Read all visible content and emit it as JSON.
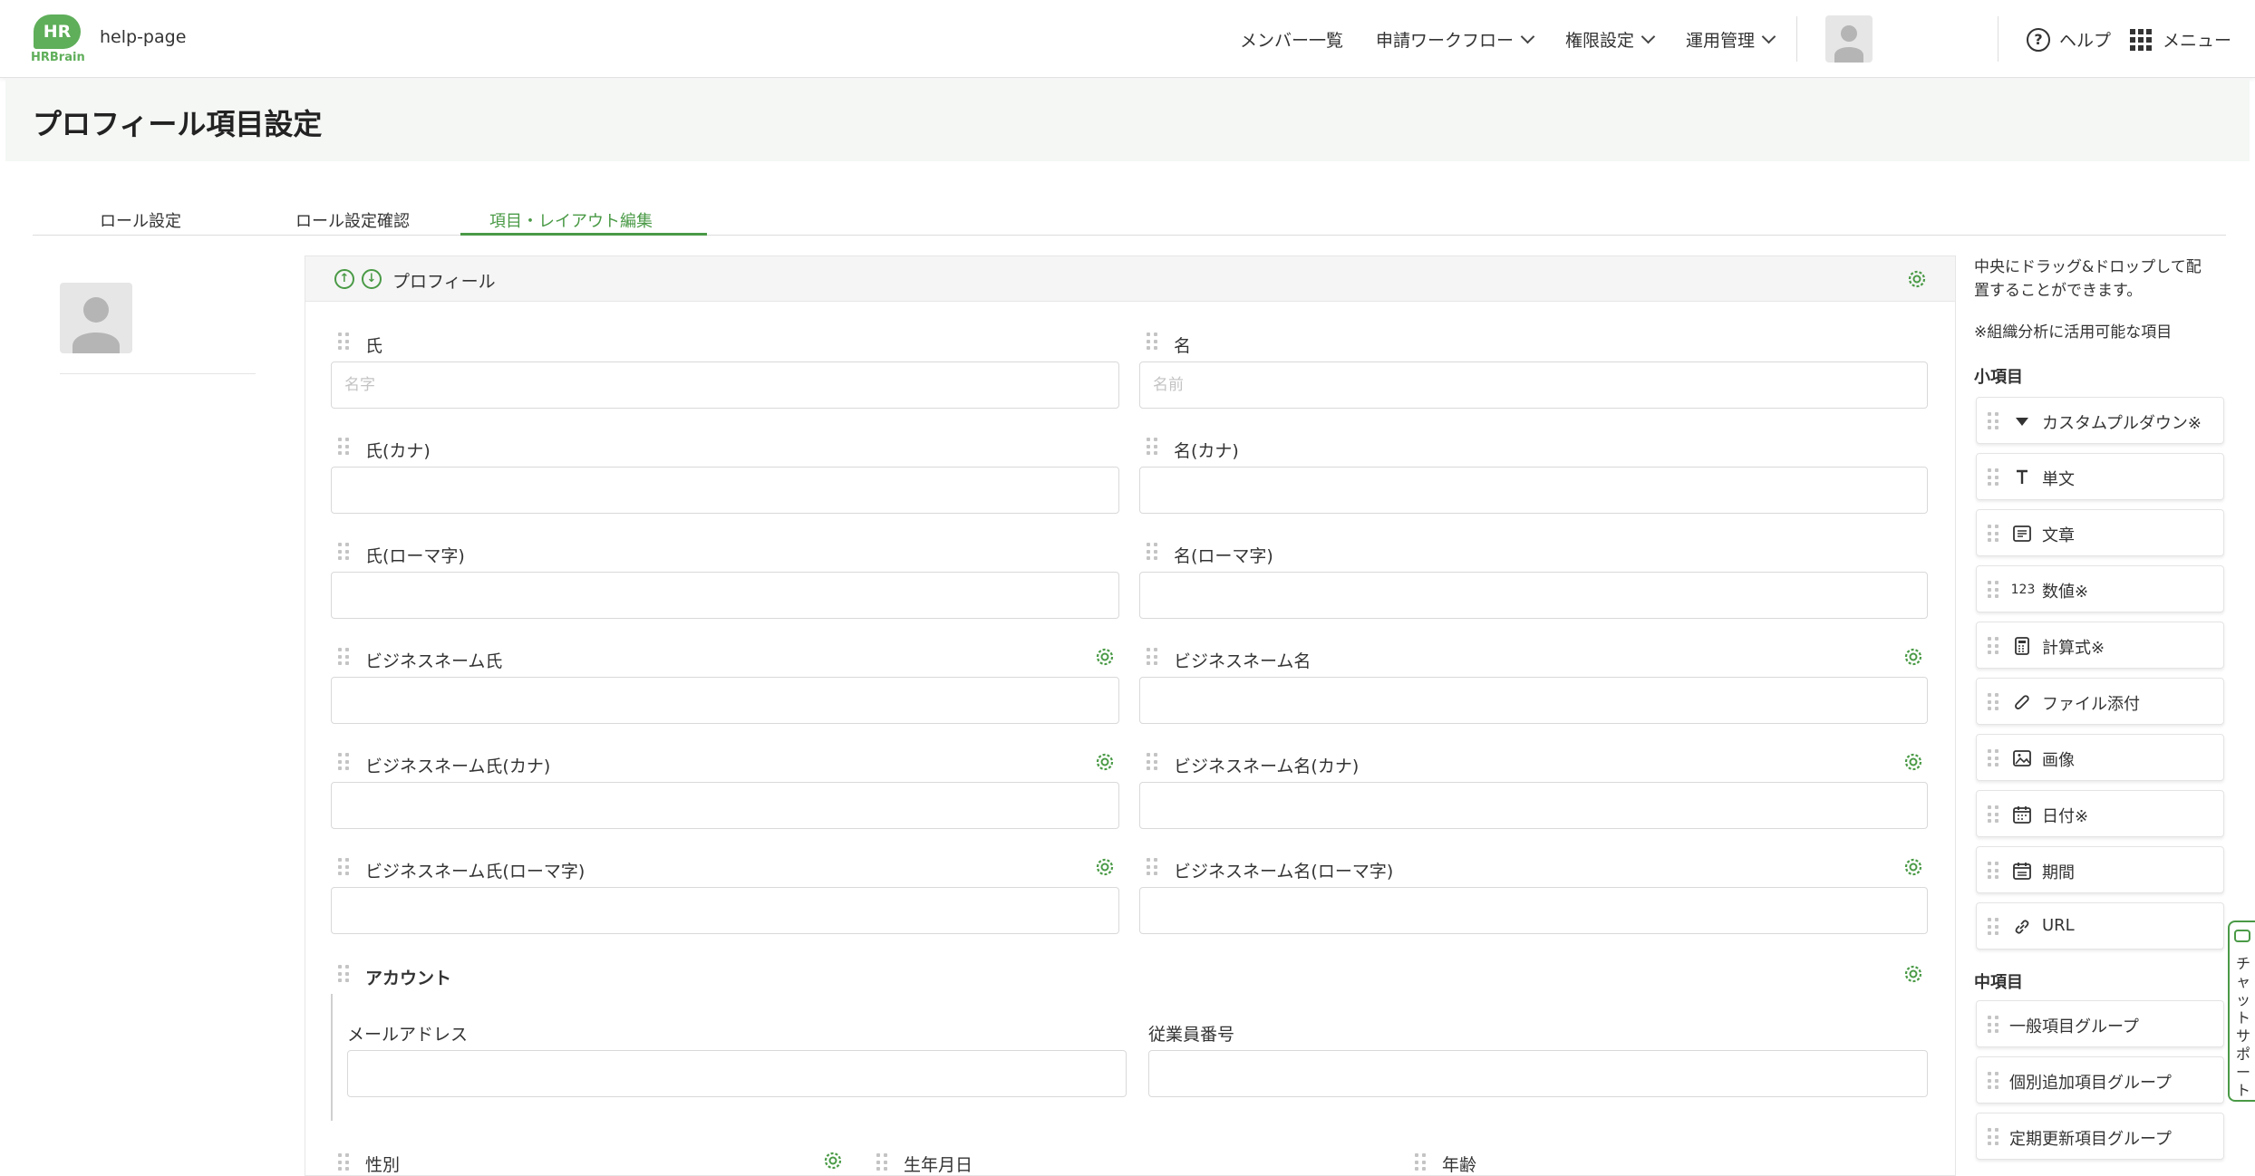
{
  "header": {
    "logo_text": "HR",
    "logo_sub": "HRBrain",
    "site_name": "help-page",
    "nav": [
      {
        "label": "メンバー一覧"
      },
      {
        "label": "申請ワークフロー"
      },
      {
        "label": "権限設定"
      },
      {
        "label": "運用管理"
      }
    ],
    "help_label": "ヘルプ",
    "menu_label": "メニュー"
  },
  "page": {
    "title": "プロフィール項目設定"
  },
  "tabs": [
    {
      "label": "ロール設定"
    },
    {
      "label": "ロール設定確認"
    },
    {
      "label": "項目・レイアウト編集"
    }
  ],
  "panel": {
    "title": "プロフィール",
    "fields": {
      "last_name": {
        "label": "氏",
        "placeholder": "名字"
      },
      "first_name": {
        "label": "名",
        "placeholder": "名前"
      },
      "last_kana": {
        "label": "氏(カナ)"
      },
      "first_kana": {
        "label": "名(カナ)"
      },
      "last_roma": {
        "label": "氏(ローマ字)"
      },
      "first_roma": {
        "label": "名(ローマ字)"
      },
      "biz_last": {
        "label": "ビジネスネーム氏"
      },
      "biz_first": {
        "label": "ビジネスネーム名"
      },
      "biz_last_kana": {
        "label": "ビジネスネーム氏(カナ)"
      },
      "biz_first_kana": {
        "label": "ビジネスネーム名(カナ)"
      },
      "biz_last_roma": {
        "label": "ビジネスネーム氏(ローマ字)"
      },
      "biz_first_roma": {
        "label": "ビジネスネーム名(ローマ字)"
      }
    },
    "account": {
      "title": "アカウント",
      "email_label": "メールアドレス",
      "employee_no_label": "従業員番号"
    },
    "bottom": {
      "gender_label": "性別",
      "birthday_label": "生年月日",
      "age_label": "年齢"
    }
  },
  "sidebar": {
    "note_line1": "中央にドラッグ&ドロップして配",
    "note_line2": "置することができます。",
    "note_org": "※組織分析に活用可能な項目",
    "small_title": "小項目",
    "small_items": [
      {
        "label": "カスタムプルダウン※",
        "icon": "triangle-down-icon"
      },
      {
        "label": "単文",
        "icon": "text-t-icon"
      },
      {
        "label": "文章",
        "icon": "paragraph-icon"
      },
      {
        "label": "数値※",
        "icon": "number-icon",
        "icon_text": "123"
      },
      {
        "label": "計算式※",
        "icon": "calculator-icon"
      },
      {
        "label": "ファイル添付",
        "icon": "paperclip-icon"
      },
      {
        "label": "画像",
        "icon": "image-icon"
      },
      {
        "label": "日付※",
        "icon": "calendar-icon"
      },
      {
        "label": "期間",
        "icon": "calendar-range-icon"
      },
      {
        "label": "URL",
        "icon": "link-icon"
      }
    ],
    "medium_title": "中項目",
    "medium_items": [
      {
        "label": "一般項目グループ"
      },
      {
        "label": "個別追加項目グループ"
      },
      {
        "label": "定期更新項目グループ"
      }
    ]
  },
  "chat": {
    "label": "チャットサポート"
  },
  "colors": {
    "accent": "#4a9a46",
    "logo": "#5fae5a"
  }
}
